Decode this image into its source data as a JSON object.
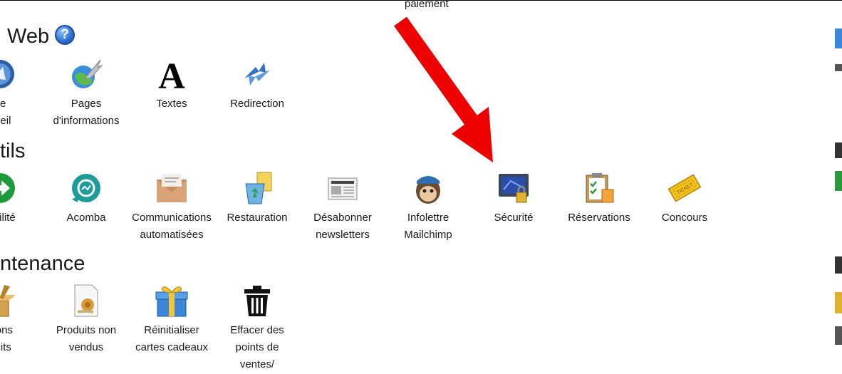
{
  "top_clipped_label": "paiement",
  "sections": {
    "web": {
      "title": "Web",
      "help_glyph": "?"
    },
    "outils": {
      "title": "tils"
    },
    "maintenance": {
      "title": "ntenance"
    }
  },
  "web_items": [
    {
      "line1": "ge",
      "line2": "cueil",
      "icon": "home-page-icon"
    },
    {
      "line1": "Pages",
      "line2": "d'informations",
      "icon": "globe-feather-icon"
    },
    {
      "line1": "Textes",
      "line2": "",
      "icon": "letter-a-icon"
    },
    {
      "line1": "Redirection",
      "line2": "",
      "icon": "redirect-arrows-icon"
    }
  ],
  "tools_items": [
    {
      "line1": "tabilité",
      "line2": "",
      "icon": "green-arrow-icon"
    },
    {
      "line1": "Acomba",
      "line2": "",
      "icon": "acomba-logo-icon"
    },
    {
      "line1": "Communications",
      "line2": "automatisées",
      "icon": "envelope-icon"
    },
    {
      "line1": "Restauration",
      "line2": "",
      "icon": "recycle-bin-icon"
    },
    {
      "line1": "Désabonner",
      "line2": "newsletters",
      "icon": "newspaper-icon"
    },
    {
      "line1": "Infolettre",
      "line2": "Mailchimp",
      "icon": "mailchimp-icon"
    },
    {
      "line1": "Sécurité",
      "line2": "",
      "icon": "security-monitor-lock-icon"
    },
    {
      "line1": "Réservations",
      "line2": "",
      "icon": "clipboard-checklist-icon"
    },
    {
      "line1": "Concours",
      "line2": "",
      "icon": "ticket-icon"
    }
  ],
  "maintenance_items": [
    {
      "line1": "olons",
      "line2": "duits",
      "icon": "box-brush-icon"
    },
    {
      "line1": "Produits non",
      "line2": "vendus",
      "icon": "snail-document-icon"
    },
    {
      "line1": "Réinitialiser",
      "line2": "cartes cadeaux",
      "icon": "gift-box-icon"
    },
    {
      "line1": "Effacer des",
      "line2": "points de",
      "line3": "ventes/",
      "icon": "trash-can-icon"
    }
  ],
  "annotation": {
    "color": "#ee0000"
  },
  "colors": {
    "text": "#1a1a1a",
    "help_blue": "#2d6fd1"
  }
}
